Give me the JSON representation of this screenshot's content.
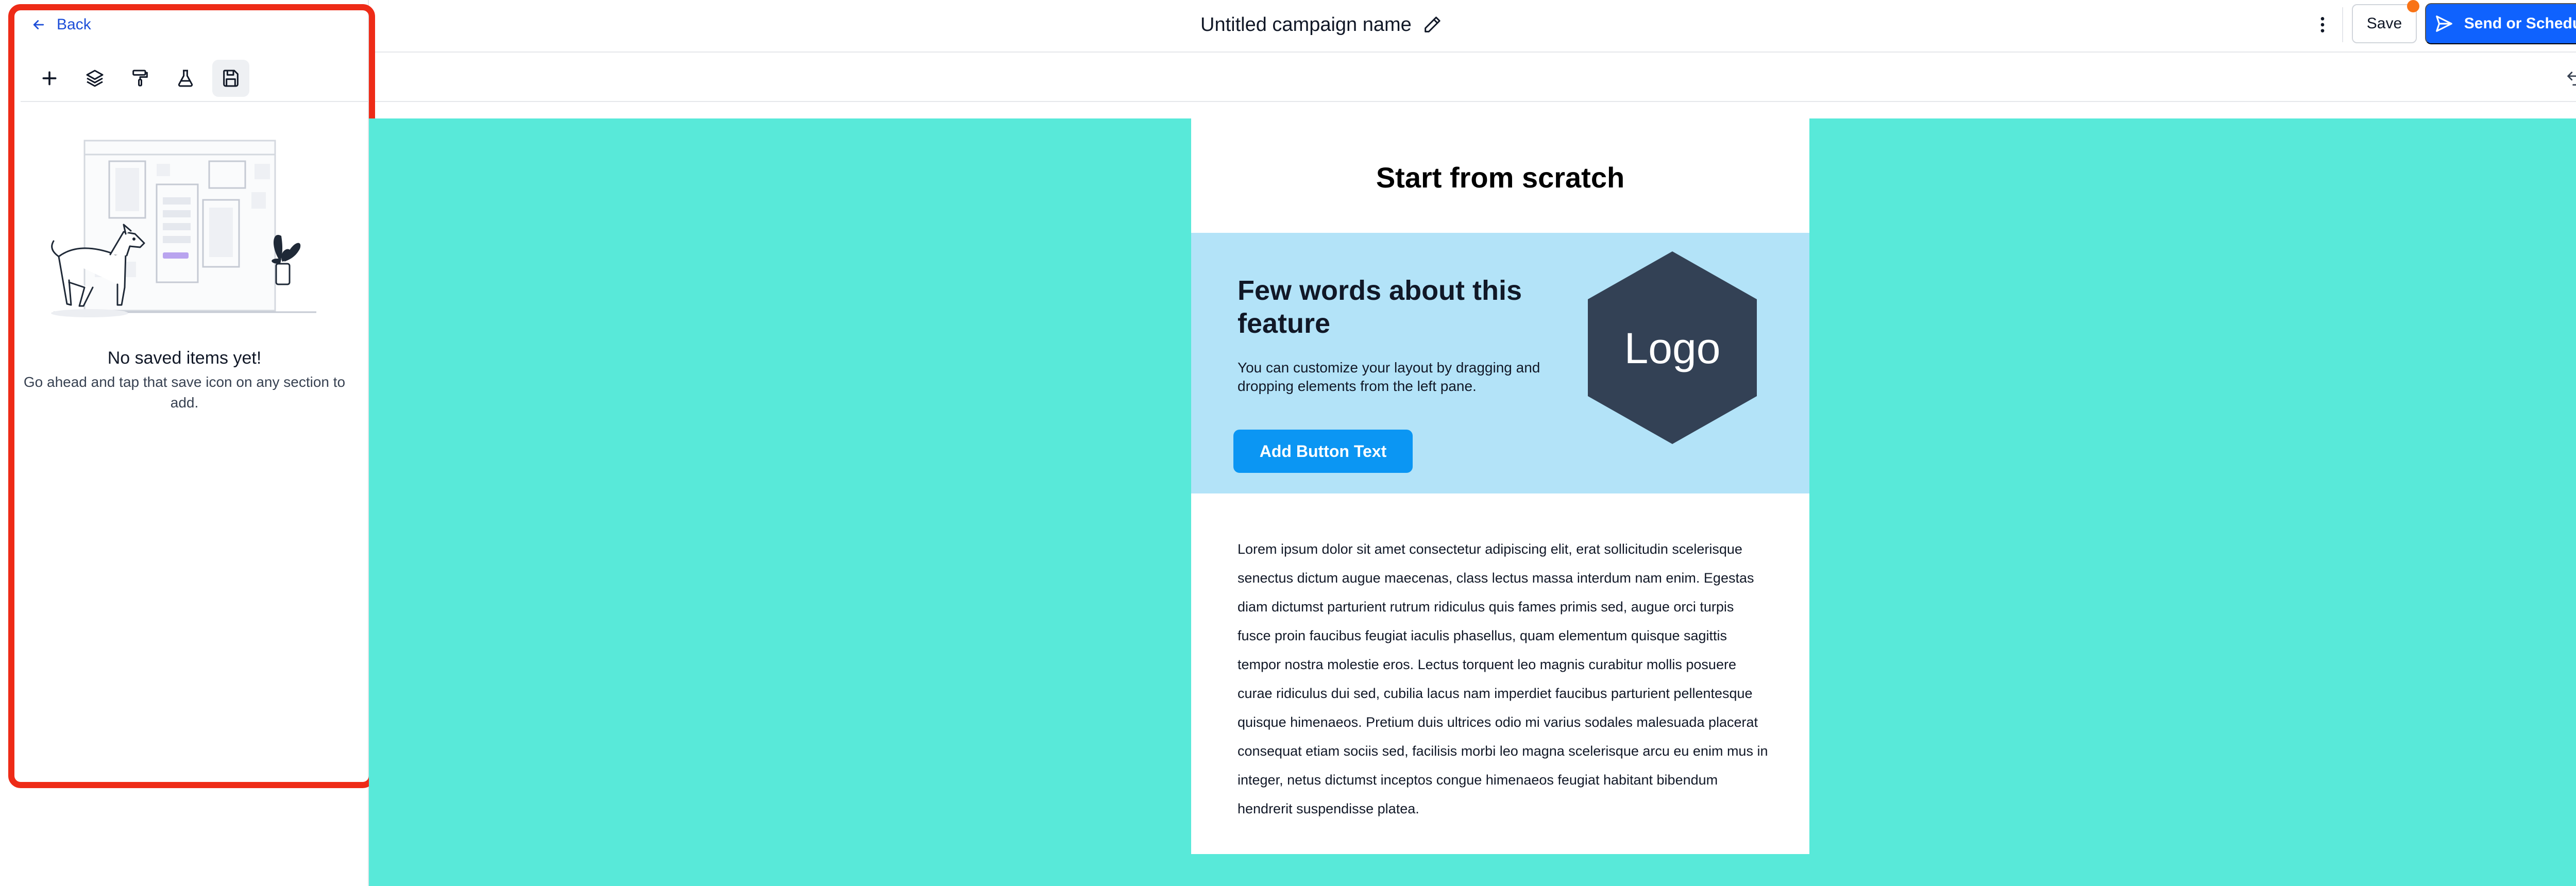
{
  "header": {
    "back_label": "Back",
    "campaign_title": "Untitled campaign name",
    "save_label": "Save",
    "send_label": "Send or Schedule"
  },
  "left_panel": {
    "tools": [
      "add-icon",
      "layers-icon",
      "paint-roller-icon",
      "flask-icon",
      "save-icon"
    ],
    "active_tool": "save-icon",
    "empty_title": "No saved items yet!",
    "empty_subtitle": "Go ahead and tap that save icon on any section to add."
  },
  "email": {
    "heading": "Start from scratch",
    "hero_title": "Few words about this feature",
    "hero_text": "You can customize your layout by dragging and dropping elements from the left pane.",
    "hero_button": "Add Button Text",
    "logo_text": "Logo",
    "body": "Lorem ipsum dolor sit amet consectetur adipiscing elit, erat sollicitudin scelerisque senectus dictum augue maecenas, class lectus massa interdum nam enim. Egestas diam dictumst parturient rutrum ridiculus quis fames primis sed, augue orci turpis fusce proin faucibus feugiat iaculis phasellus, quam elementum quisque sagittis tempor nostra molestie eros. Lectus torquent leo magnis curabitur mollis posuere curae ridiculus dui sed, cubilia lacus nam imperdiet faucibus parturient pellentesque quisque himenaeos. Pretium duis ultrices odio mi varius sodales malesuada placerat consequat etiam sociis sed, facilisis morbi leo magna scelerisque arcu eu enim mus in integer, netus dictumst inceptos congue himenaeos feugiat habitant bibendum hendrerit suspendisse platea."
  },
  "colors": {
    "canvas_bg": "#58e9d9",
    "hero_bg": "#b3e3f8",
    "primary": "#0f62fe",
    "hero_button": "#0b96f3",
    "logo_hex": "#334155",
    "highlight": "#ee2b17"
  }
}
